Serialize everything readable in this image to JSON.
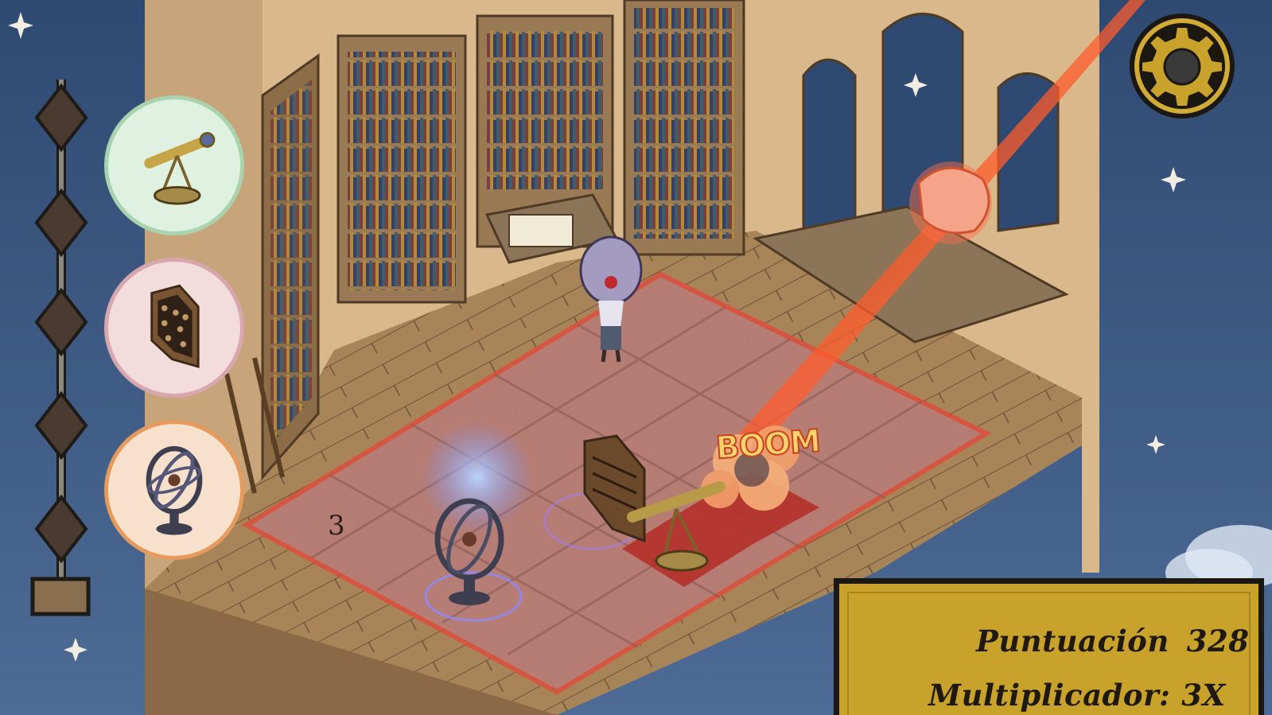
{
  "hud": {
    "score_label": "Puntuación",
    "score_value": "328",
    "multiplier_label": "Multiplicador:",
    "multiplier_value": "3X"
  },
  "board": {
    "tile_number": "3",
    "boom_text": "BOOM"
  },
  "item_slots": [
    {
      "name": "telescope",
      "icon": "telescope-icon"
    },
    {
      "name": "abacus",
      "icon": "abacus-icon"
    },
    {
      "name": "armillary-sphere",
      "icon": "armillary-sphere-icon"
    }
  ],
  "progress": {
    "segments": 5,
    "filled": 0
  },
  "colors": {
    "sky": "#3a5680",
    "score_panel": "#c9a22b",
    "danger_tile": "#b5302a",
    "board_border": "#d9533f",
    "settings_gold": "#c9a22b"
  },
  "icons": [
    "gear-icon",
    "star-icon",
    "meteor-icon",
    "wizard-character"
  ]
}
